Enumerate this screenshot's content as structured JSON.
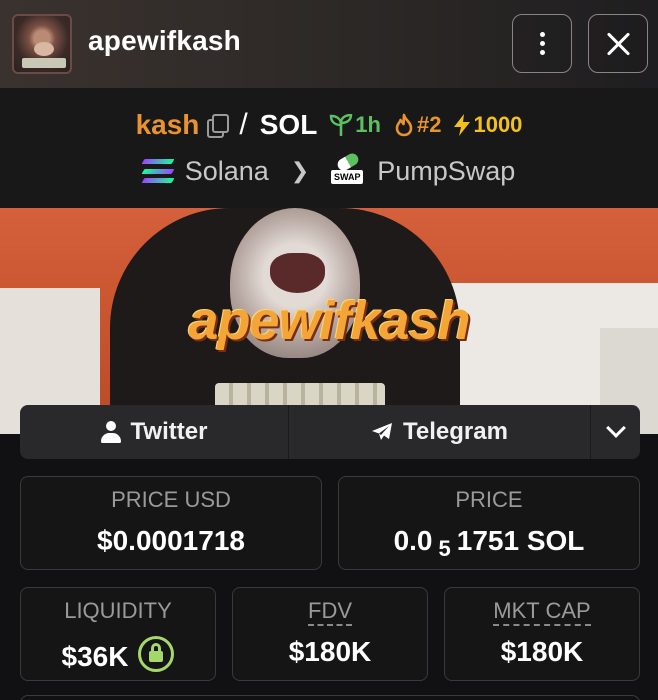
{
  "header": {
    "title": "apewifkash"
  },
  "pair": {
    "base_symbol": "kash",
    "separator": "/",
    "quote_symbol": "SOL",
    "age": "1h",
    "rank": "#2",
    "boosts": "1000",
    "chain": "Solana",
    "dex": "PumpSwap",
    "dex_badge": "SWAP"
  },
  "banner": {
    "text": "apewifkash"
  },
  "social": {
    "twitter_label": "Twitter",
    "telegram_label": "Telegram"
  },
  "stats": {
    "price_usd_label": "PRICE USD",
    "price_usd_value": "$0.0001718",
    "price_label": "PRICE",
    "price_prefix": "0.0",
    "price_zeros": "5",
    "price_digits": "1751 SOL",
    "liquidity_label": "LIQUIDITY",
    "liquidity_value": "$36K",
    "fdv_label": "FDV",
    "fdv_value": "$180K",
    "mcap_label": "MKT CAP",
    "mcap_value": "$180K"
  },
  "colors": {
    "base_symbol": "#e8932f",
    "age_badge": "#5cc062",
    "rank_badge": "#e8932f",
    "boost_badge": "#f2c11b",
    "lock": "#a5d86a"
  },
  "icons": [
    "token-avatar",
    "kebab-menu-icon",
    "close-icon",
    "copy-icon",
    "seedling-icon",
    "flame-icon",
    "lightning-icon",
    "solana-icon",
    "chevron-right-icon",
    "pumpswap-icon",
    "user-icon",
    "telegram-icon",
    "chevron-down-icon",
    "lock-icon"
  ]
}
